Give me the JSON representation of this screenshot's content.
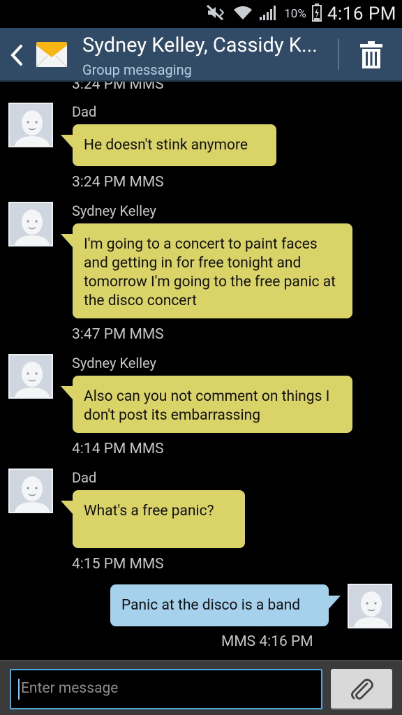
{
  "status_bar": {
    "battery": "10%",
    "time": "4:16 PM",
    "icons": [
      "mute-icon",
      "wifi-icon",
      "signal-icon",
      "battery-icon"
    ]
  },
  "header": {
    "title": "Sydney Kelley, Cassidy K...",
    "subtitle": "Group messaging",
    "icons": [
      "back-icon",
      "messaging-app-icon",
      "trash-icon"
    ]
  },
  "conversation": {
    "top_cut_timestamp": "3:24 PM MMS",
    "messages": [
      {
        "sender": "Dad",
        "text": "He doesn't stink anymore",
        "timestamp": "3:24 PM MMS",
        "direction": "incoming"
      },
      {
        "sender": "Sydney Kelley",
        "text": "I'm going to a concert to paint faces and getting in for free tonight and tomorrow I'm going to the free panic at the disco concert",
        "timestamp": "3:47 PM MMS",
        "direction": "incoming"
      },
      {
        "sender": "Sydney Kelley",
        "text": "Also can you not comment on things I don't post its embarrassing",
        "timestamp": "4:14 PM MMS",
        "direction": "incoming"
      },
      {
        "sender": "Dad",
        "text": "What's a free panic?",
        "timestamp": "4:15 PM MMS",
        "direction": "incoming"
      },
      {
        "sender": "",
        "text": "Panic at the disco is a band",
        "timestamp": "MMS 4:16 PM",
        "direction": "outgoing"
      }
    ]
  },
  "composer": {
    "placeholder": "Enter message",
    "attach_icon": "paperclip-icon"
  },
  "colors": {
    "header_bg": "#314a66",
    "incoming_bubble": "#dad468",
    "outgoing_bubble": "#a6d1ec",
    "input_border": "#4fa7dc"
  }
}
